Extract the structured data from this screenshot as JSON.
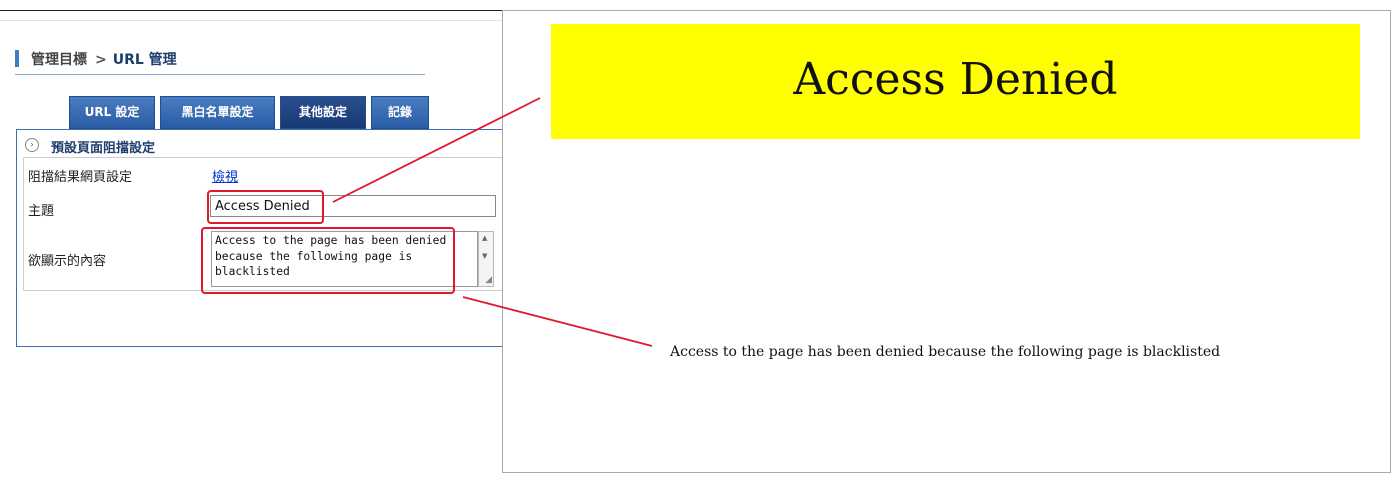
{
  "breadcrumb": {
    "section": "管理目標",
    "separator": ">",
    "page": "URL 管理"
  },
  "tabs": [
    {
      "label": "URL 設定",
      "active": false
    },
    {
      "label": "黑白名單設定",
      "active": false
    },
    {
      "label": "其他設定",
      "active": true
    },
    {
      "label": "記錄",
      "active": false
    }
  ],
  "section": {
    "title": "預設頁面阻擋設定",
    "icon": "expand-arrow-icon"
  },
  "form": {
    "block_page_label": "阻擋結果網頁設定",
    "view_link": "檢視",
    "subject_label": "主題",
    "subject_value": "Access Denied",
    "content_label": "欲顯示的內容",
    "content_value": "Access to the page has been denied because the following page is blacklisted"
  },
  "preview": {
    "banner_text": "Access Denied",
    "banner_color": "#ffff00",
    "body_text": "Access to the page has been denied because the following page is blacklisted"
  },
  "colors": {
    "annotation": "#e0182d",
    "tab": "#2a5ca6",
    "link": "#0033cc"
  }
}
